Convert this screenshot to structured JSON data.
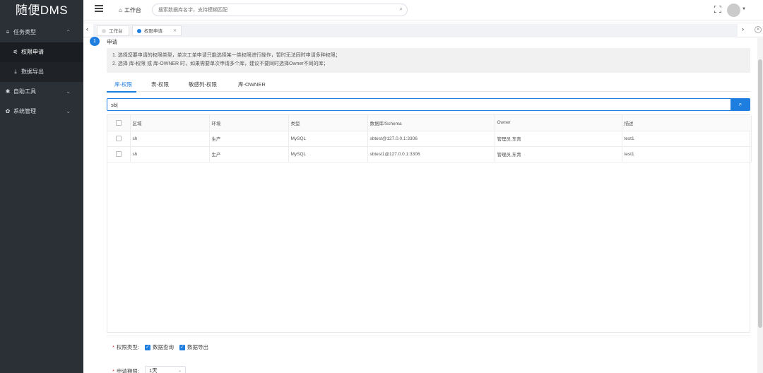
{
  "app": {
    "logo": "随便DMS"
  },
  "sidebar": {
    "items": [
      {
        "label": "任务类型",
        "icon": "list-icon",
        "expanded": true,
        "children": [
          {
            "label": "权限申请",
            "icon": "filter-icon",
            "active": true
          },
          {
            "label": "数据导出",
            "icon": "download-icon",
            "active": false
          }
        ]
      },
      {
        "label": "自助工具",
        "icon": "tools-icon",
        "expanded": false
      },
      {
        "label": "系统管理",
        "icon": "gear-icon",
        "expanded": false
      }
    ]
  },
  "header": {
    "home_label": "工作台",
    "search_placeholder": "搜索数据库名字，支持模糊匹配"
  },
  "tabs": [
    {
      "label": "工作台",
      "active": false
    },
    {
      "label": "权限申请",
      "active": true
    }
  ],
  "main": {
    "step_number": "1",
    "step_title": "申请",
    "notice_lines": [
      "1. 选择您要申请的权限类型，单次工单申请只能选择某一类权限进行操作，暂时无法同时申请多种权限；",
      "2. 选择 库-权限 或 库-OWNER 时，如果需要单次申请多个库，建议不要同时选择Owner不同的库；"
    ],
    "type_tabs": [
      "库-权限",
      "表-权限",
      "敏感列-权限",
      "库-OWNER"
    ],
    "filter_value": "sb|",
    "table": {
      "columns": [
        "区域",
        "环境",
        "类型",
        "数据库/Schema",
        "Owner",
        "描述"
      ],
      "rows": [
        [
          "sh",
          "生产",
          "MySQL",
          "sbtest@127.0.0.1:3306",
          "管理员,东青",
          "test1"
        ],
        [
          "sh",
          "生产",
          "MySQL",
          "sbtest1@127.0.0.1:3306",
          "管理员,东青",
          "test1"
        ]
      ]
    },
    "form": {
      "perm_type_label": "权限类型:",
      "perm_options": [
        "数据查询",
        "数据导出"
      ],
      "period_label": "申请期限:",
      "period_value": "1天"
    }
  },
  "colors": {
    "accent": "#1e7ee0",
    "sidebar_bg": "#2b2f36"
  }
}
